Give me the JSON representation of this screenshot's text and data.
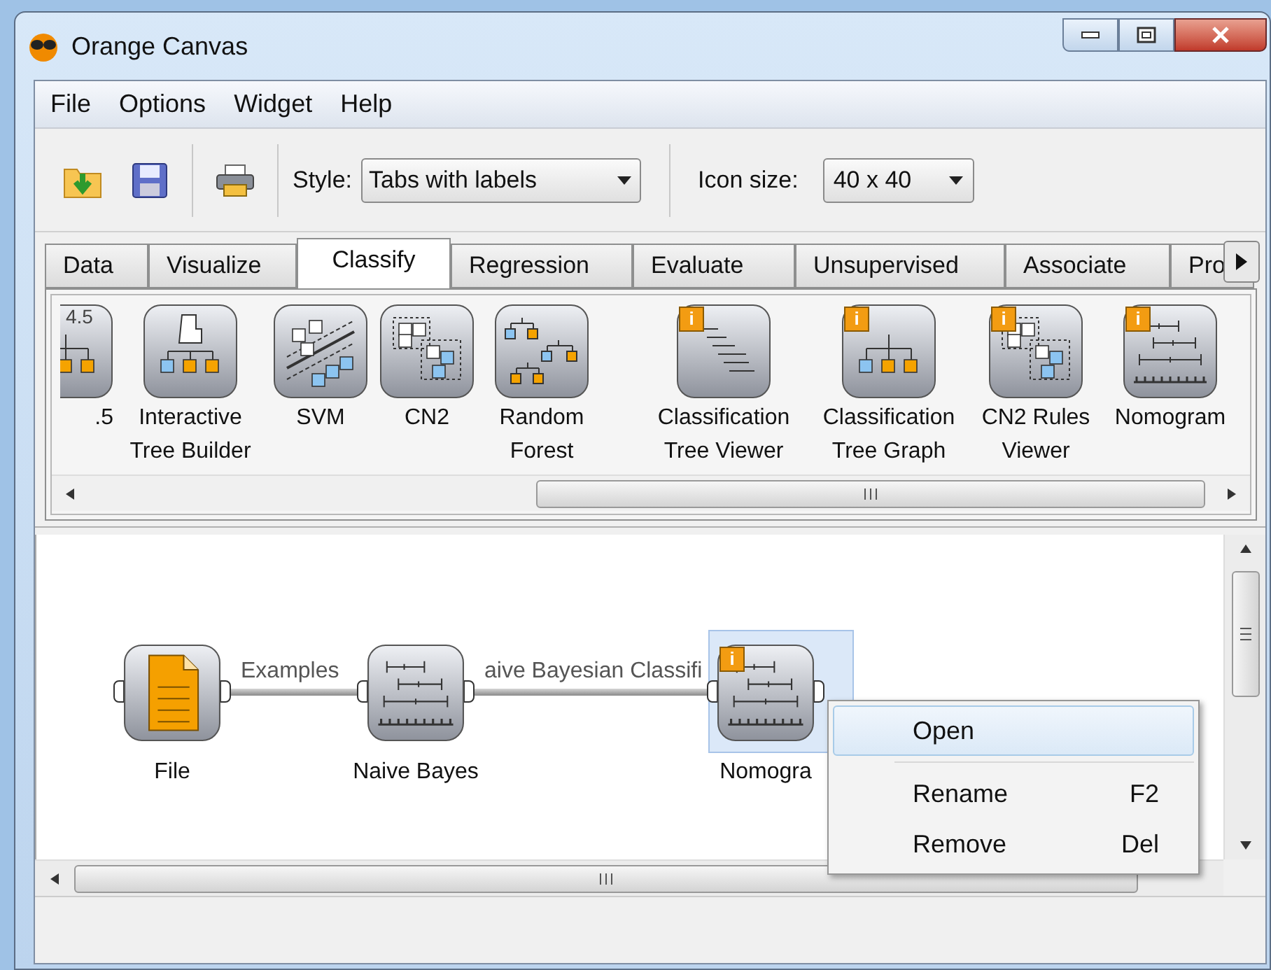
{
  "window": {
    "title": "Orange Canvas"
  },
  "menu": [
    "File",
    "Options",
    "Widget",
    "Help"
  ],
  "toolbar": {
    "style_label": "Style:",
    "style_value": "Tabs with labels",
    "icon_size_label": "Icon size:",
    "icon_size_value": "40 x 40"
  },
  "tabs": [
    {
      "label": "Data",
      "selected": false
    },
    {
      "label": "Visualize",
      "selected": false
    },
    {
      "label": "Classify",
      "selected": true
    },
    {
      "label": "Regression",
      "selected": false
    },
    {
      "label": "Evaluate",
      "selected": false
    },
    {
      "label": "Unsupervised",
      "selected": false
    },
    {
      "label": "Associate",
      "selected": false
    },
    {
      "label": "Pro",
      "selected": false
    }
  ],
  "widgets": [
    {
      "label": ".5",
      "kind": "tree",
      "icon_text": "4.5"
    },
    {
      "label": "Interactive Tree Builder",
      "kind": "hand-tree"
    },
    {
      "label": "SVM",
      "kind": "svm"
    },
    {
      "label": "CN2",
      "kind": "cn2"
    },
    {
      "label": "Random Forest",
      "kind": "forest"
    },
    {
      "label": "Classification Tree Viewer",
      "kind": "lines",
      "info": "i"
    },
    {
      "label": "Classification Tree Graph",
      "kind": "tree",
      "info": "i"
    },
    {
      "label": "CN2 Rules Viewer",
      "kind": "cn2",
      "info": "i"
    },
    {
      "label": "Nomogram",
      "kind": "nomogram",
      "info": "i"
    }
  ],
  "canvas": {
    "nodes": [
      {
        "label": "File",
        "kind": "file",
        "selected": false
      },
      {
        "label": "Naive Bayes",
        "kind": "nomogram",
        "selected": false
      },
      {
        "label": "Nomogra",
        "kind": "nomogram",
        "info": "i",
        "selected": true
      }
    ],
    "links": [
      {
        "label": "Examples"
      },
      {
        "label": "aive Bayesian Classifi"
      }
    ]
  },
  "context_menu": [
    {
      "kind": "item",
      "label": "Open",
      "selected": true
    },
    {
      "kind": "separator"
    },
    {
      "kind": "item",
      "label": "Rename",
      "shortcut": "F2",
      "selected": false
    },
    {
      "kind": "item",
      "label": "Remove",
      "shortcut": "Del",
      "selected": false
    }
  ]
}
